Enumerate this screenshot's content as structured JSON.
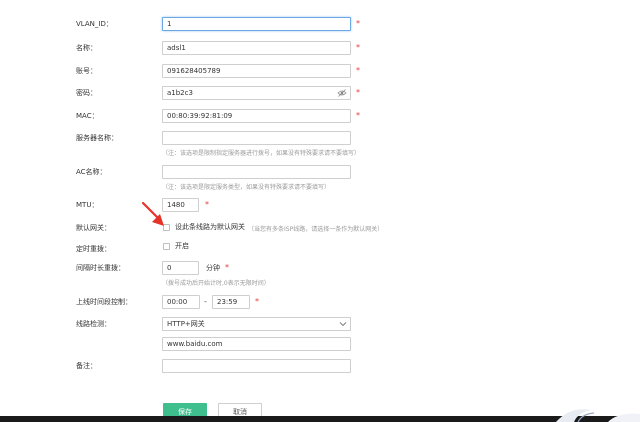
{
  "form": {
    "vlan_id": {
      "label": "VLAN_ID：",
      "value": "1"
    },
    "name": {
      "label": "名称：",
      "value": "adsl1"
    },
    "account": {
      "label": "账号：",
      "value": "091628405789"
    },
    "password": {
      "label": "密码：",
      "value": "a1b2c3"
    },
    "mac": {
      "label": "MAC：",
      "value": "00:80:39:92:81:09"
    },
    "server_name": {
      "label": "服务器名称：",
      "value": "",
      "hint": "（注：该选项是限制指定服务器进行拨号，如果没有特殊要求请不要填写）"
    },
    "ac_name": {
      "label": "AC名称：",
      "value": "",
      "hint": "（注：该选项是限定服务类型，如果没有特殊要求请不要填写）"
    },
    "mtu": {
      "label": "MTU：",
      "value": "1480"
    },
    "default_gateway": {
      "label": "默认网关：",
      "checkbox_label": "设此条线路为默认网关",
      "hint": "（当您有多条ISP线路，请选择一条作为默认网关）"
    },
    "scheduled_redial": {
      "label": "定时重拨：",
      "checkbox_label": "开启"
    },
    "interval_redial": {
      "label": "间隔时长重拨：",
      "value": "0",
      "unit": "分钟",
      "hint": "（拨号成功后开始计时,0表示无限时间）"
    },
    "online_time": {
      "label": "上线时间段控制：",
      "start": "00:00",
      "separator": "-",
      "end": "23:59"
    },
    "line_detect": {
      "label": "线路检测：",
      "selected": "HTTP+网关",
      "url": "www.baidu.com"
    },
    "remark": {
      "label": "备注：",
      "value": ""
    },
    "required_mark": "*"
  },
  "buttons": {
    "save": "保存",
    "cancel": "取消"
  },
  "colors": {
    "primary": "#3fbf8e",
    "required": "#e03c3c",
    "focus_border": "#6aa8e6",
    "annotation_arrow": "#e5332a"
  }
}
